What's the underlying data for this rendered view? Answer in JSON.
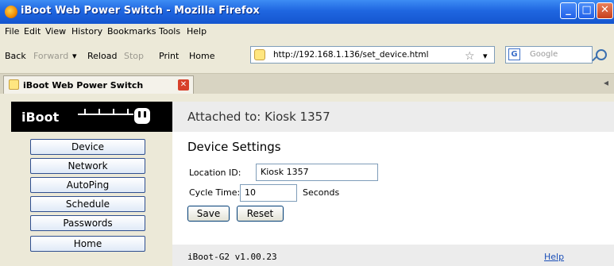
{
  "window": {
    "title": "iBoot Web Power Switch - Mozilla Firefox"
  },
  "menu": [
    "File",
    "Edit",
    "View",
    "History",
    "Bookmarks",
    "Tools",
    "Help"
  ],
  "nav": {
    "back": "Back",
    "forward": "Forward",
    "reload": "Reload",
    "stop": "Stop",
    "print": "Print",
    "home": "Home"
  },
  "url": "http://192.168.1.136/set_device.html",
  "search_placeholder": "Google",
  "tab": {
    "label": "iBoot Web Power Switch"
  },
  "logo_text": "iBoot",
  "sidebar": [
    "Device",
    "Network",
    "AutoPing",
    "Schedule",
    "Passwords",
    "Home"
  ],
  "attached": "Attached to: Kiosk 1357",
  "settings": {
    "title": "Device Settings",
    "location_label": "Location ID:",
    "location_value": "Kiosk 1357",
    "cycle_label": "Cycle Time:",
    "cycle_value": "10",
    "cycle_unit": "Seconds",
    "save": "Save",
    "reset": "Reset"
  },
  "footer": {
    "version": "iBoot-G2 v1.00.23",
    "help": "Help"
  }
}
